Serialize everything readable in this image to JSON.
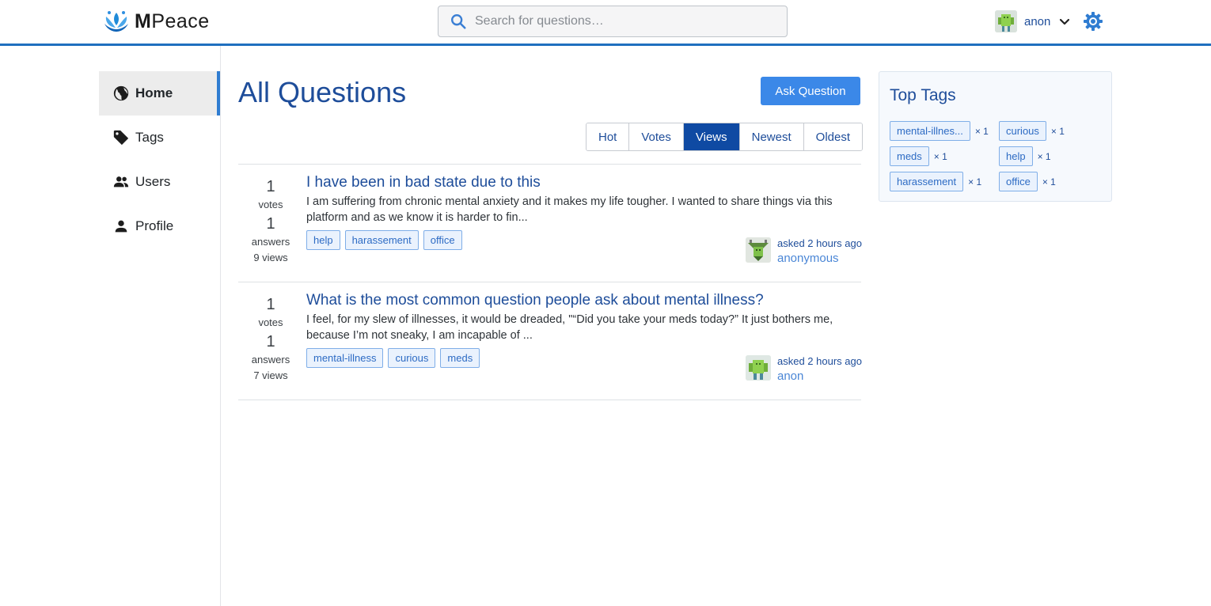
{
  "header": {
    "brand_bold": "M",
    "brand_rest": "Peace",
    "search_placeholder": "Search for questions…",
    "user_name": "anon"
  },
  "sidebar": {
    "items": [
      {
        "label": "Home",
        "icon": "globe-icon",
        "active": true
      },
      {
        "label": "Tags",
        "icon": "tag-icon",
        "active": false
      },
      {
        "label": "Users",
        "icon": "users-icon",
        "active": false
      },
      {
        "label": "Profile",
        "icon": "person-icon",
        "active": false
      }
    ]
  },
  "main": {
    "title": "All Questions",
    "ask_button": "Ask Question",
    "sort_tabs": [
      {
        "label": "Hot",
        "active": false
      },
      {
        "label": "Votes",
        "active": false
      },
      {
        "label": "Views",
        "active": true
      },
      {
        "label": "Newest",
        "active": false
      },
      {
        "label": "Oldest",
        "active": false
      }
    ],
    "questions": [
      {
        "votes": "1",
        "votes_label": "votes",
        "answers": "1",
        "answers_label": "answers",
        "views": "9 views",
        "title": "I have been in bad state due to this",
        "excerpt": "I am suffering from chronic mental anxiety and it makes my life tougher. I wanted to share things via this platform and as we know it is harder to fin...",
        "tags": [
          "help",
          "harassement",
          "office"
        ],
        "asked": "asked 2 hours ago",
        "author": "anonymous"
      },
      {
        "votes": "1",
        "votes_label": "votes",
        "answers": "1",
        "answers_label": "answers",
        "views": "7 views",
        "title": "What is the most common question people ask about mental illness?",
        "excerpt": "I feel, for my slew of illnesses, it would be dreaded, \"“Did you take your meds today?” It just bothers me, because I’m not sneaky, I am incapable of ...",
        "tags": [
          "mental-illness",
          "curious",
          "meds"
        ],
        "asked": "asked 2 hours ago",
        "author": "anon"
      }
    ]
  },
  "top_tags": {
    "title": "Top Tags",
    "items": [
      {
        "name": "mental-illnes...",
        "count": "× 1"
      },
      {
        "name": "curious",
        "count": "× 1"
      },
      {
        "name": "meds",
        "count": "× 1"
      },
      {
        "name": "help",
        "count": "× 1"
      },
      {
        "name": "harassement",
        "count": "× 1"
      },
      {
        "name": "office",
        "count": "× 1"
      }
    ]
  },
  "colors": {
    "accent": "#1f6fbf",
    "primary_button": "#3b88e8",
    "active_tab": "#0f4aa3",
    "link": "#1e4d9a"
  }
}
